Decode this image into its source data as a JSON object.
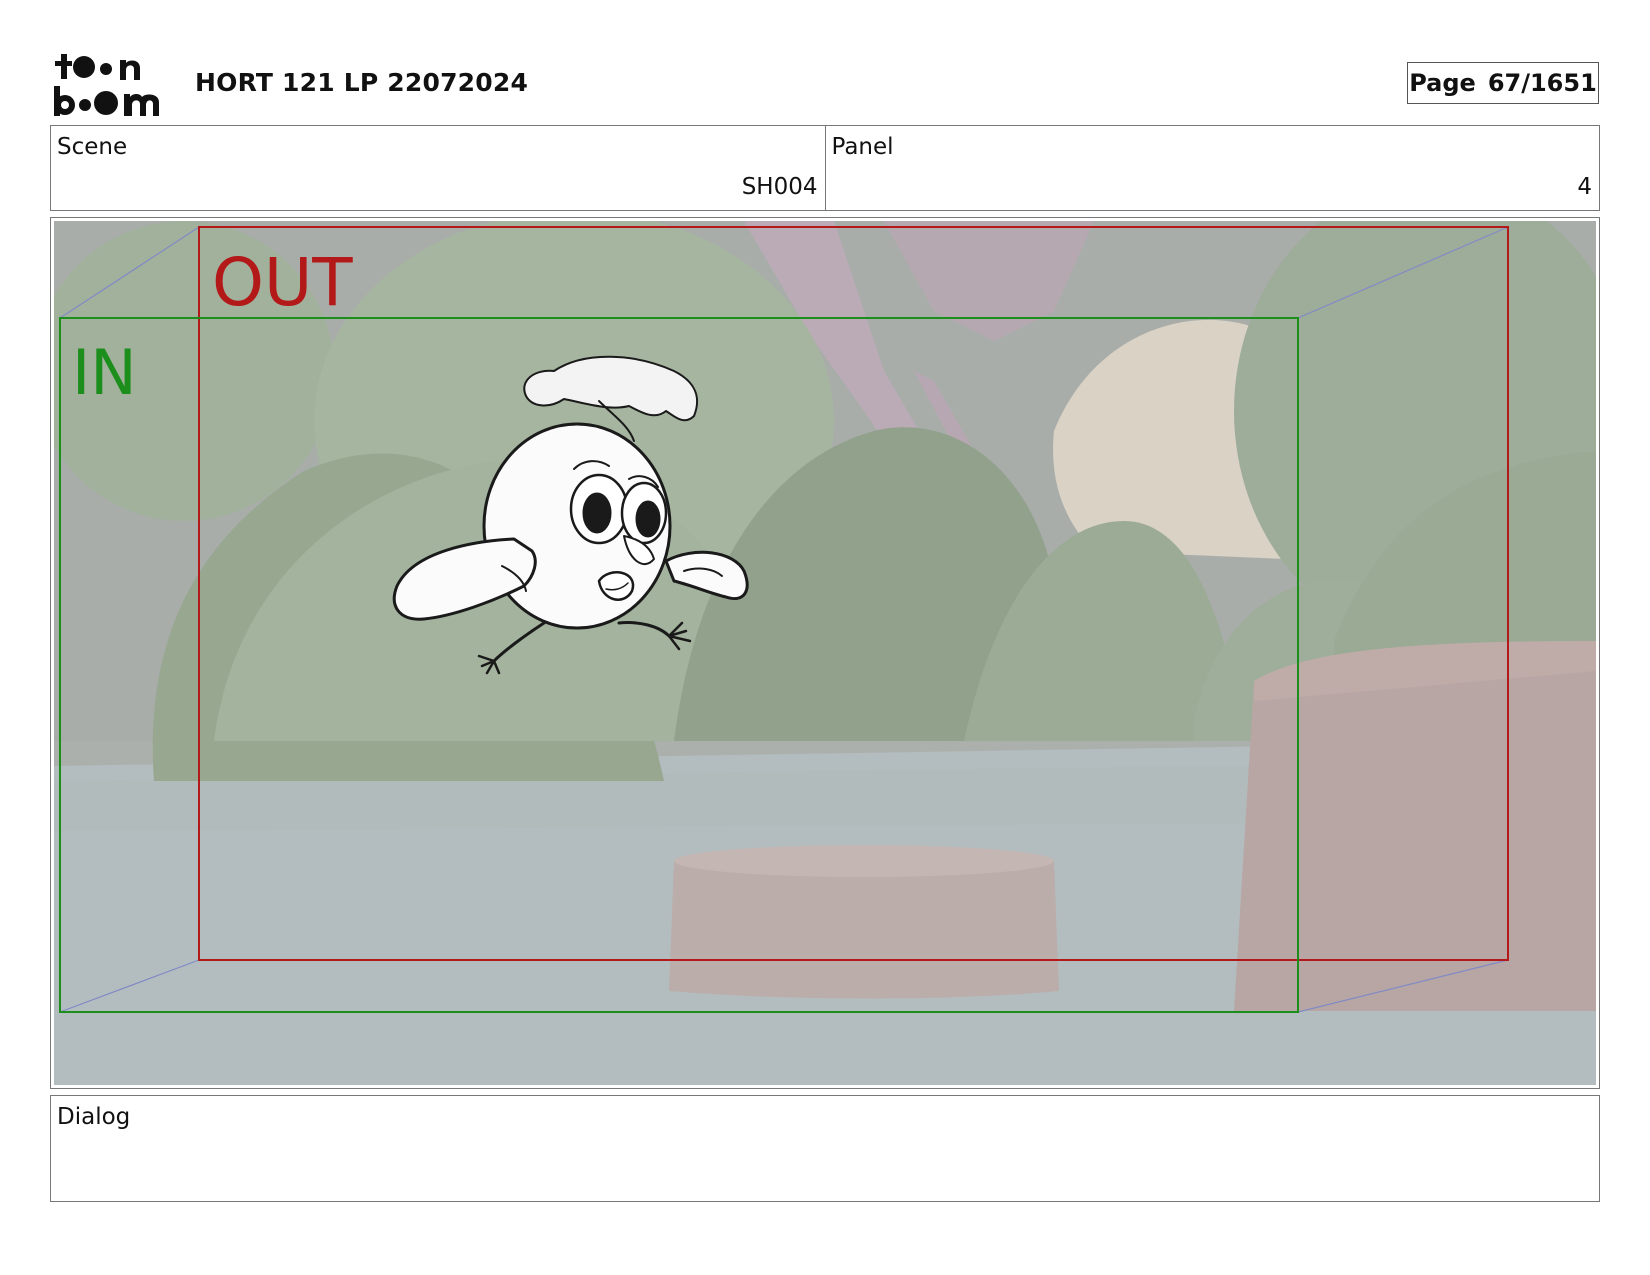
{
  "header": {
    "logo_text": "toon boom",
    "project_title": "HORT 121 LP 22072024",
    "page_label": "Page",
    "page_value": "67/1651"
  },
  "info": {
    "scene_label": "Scene",
    "scene_value": "SH004",
    "panel_label": "Panel",
    "panel_value": "4"
  },
  "frame": {
    "out_label": "OUT",
    "in_label": "IN",
    "out_color": "#b01010",
    "in_color": "#138a13"
  },
  "dialog": {
    "label": "Dialog",
    "text": ""
  }
}
